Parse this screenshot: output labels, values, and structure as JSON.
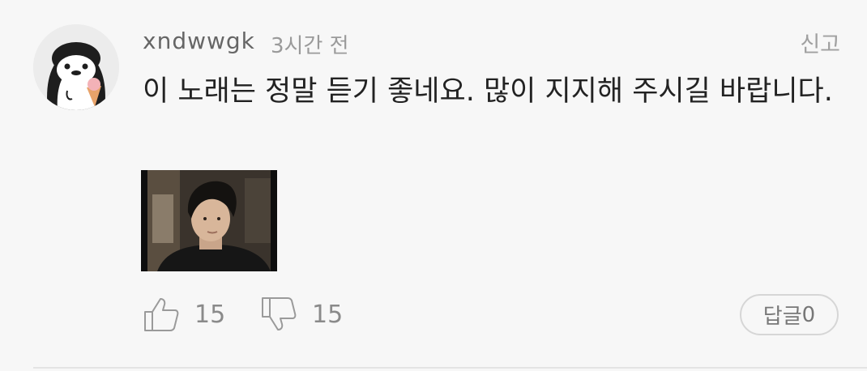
{
  "comment": {
    "username": "xndwwgk",
    "time": "3시간 전",
    "report_label": "신고",
    "text": "이 노래는 정말 듣기 좋네요. 많이 지지해 주시길 바랍니다.",
    "likes": "15",
    "dislikes": "15",
    "reply_label": "답글",
    "reply_count": "0"
  },
  "icons": {
    "avatar": "penguin-avatar",
    "like": "thumbs-up-icon",
    "dislike": "thumbs-down-icon"
  },
  "colors": {
    "background": "#f7f7f7",
    "text": "#222222",
    "muted": "#9a9a9a"
  }
}
